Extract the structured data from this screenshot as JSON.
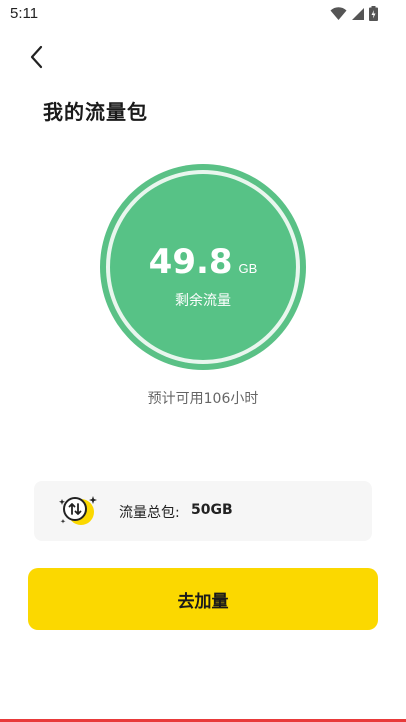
{
  "status_bar": {
    "time": "5:11",
    "icons": [
      "wifi-icon",
      "signal-icon",
      "battery-icon"
    ]
  },
  "header": {
    "back_icon": "chevron-left-icon",
    "title": "我的流量包"
  },
  "data_ring": {
    "remaining_value": "49.8",
    "remaining_unit": "GB",
    "remaining_label": "剩余流量",
    "ring_color": "#57c286"
  },
  "estimate_text": "预计可用106小时",
  "package": {
    "icon": "data-transfer-icon",
    "label": "流量总包:",
    "value": "50GB"
  },
  "cta": {
    "label": "去加量",
    "color": "#fbd800"
  }
}
